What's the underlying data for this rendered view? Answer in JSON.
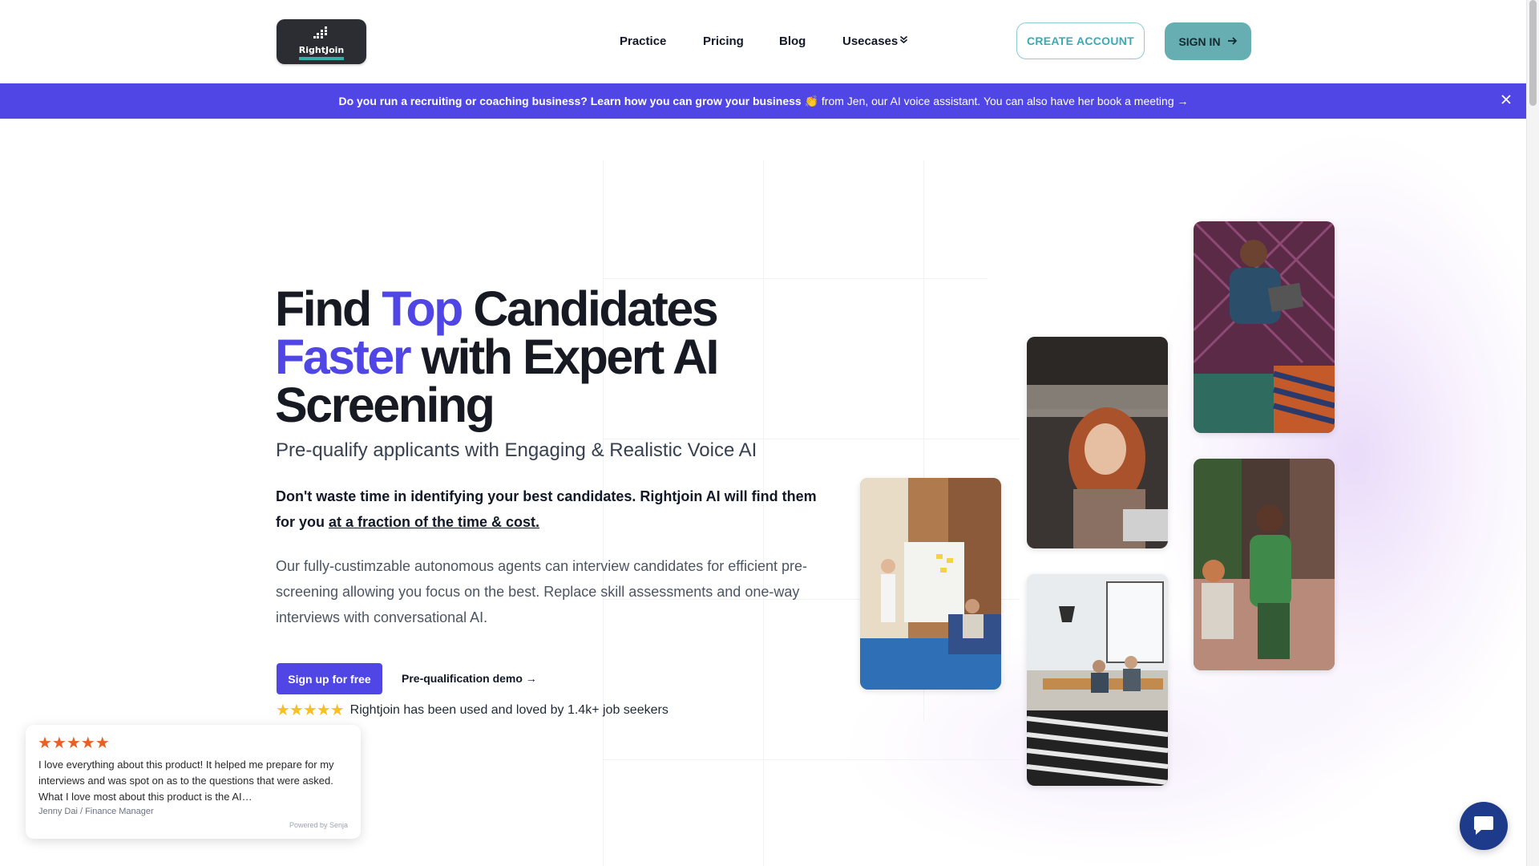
{
  "brand": {
    "name": "RightJoin"
  },
  "nav": {
    "items": [
      {
        "label": "Practice"
      },
      {
        "label": "Pricing"
      },
      {
        "label": "Blog"
      },
      {
        "label": "Usecases",
        "has_dropdown": true
      }
    ],
    "create_account": "CREATE ACCOUNT",
    "sign_in": "SIGN IN"
  },
  "announcement": {
    "bold_text": "Do you run a recruiting or coaching business? Learn how you can grow your business",
    "rest_text": " from Jen, our AI voice assistant. You can also have her book a meeting →",
    "emoji": "👏"
  },
  "hero": {
    "title": {
      "w1": "Find ",
      "w2": "Top",
      "w3": " Candidates",
      "w4": "Faster",
      "w5": " with Expert AI",
      "w6": "Screening"
    },
    "subtitle": "Pre-qualify applicants with Engaging & Realistic Voice AI",
    "lead_plain": "Don't waste time in identifying your best candidates. Rightjoin AI will find them for you ",
    "lead_underlined": "at a fraction of the time & cost.",
    "body": "Our fully-custimzable autonomous agents can interview candidates for efficient pre-screening allowing you focus on the best. Replace skill assessments and one-way interviews with conversational AI.",
    "cta_primary": "Sign up for free",
    "cta_secondary": "Pre-qualification demo →",
    "rating_stars": "★★★★★",
    "rating_text": "Rightjoin has been used and loved by 1.4k+ job seekers"
  },
  "testimonial": {
    "stars": "★★★★★",
    "quote": "I love everything about this product! It helped me prepare for my interviews and was spot on as to the questions that were asked. What I love most about this product is the AI…",
    "author": "Jenny Dai / Finance Manager",
    "powered_by": "Powered by Senja"
  },
  "colors": {
    "accent": "#4f46e5",
    "teal": "#67aeb3",
    "teal_outline": "#8ccdd2",
    "review_star": "#e4622a",
    "rating_star": "#fbbf24",
    "chat_bubble": "#1e3a8a"
  },
  "icons": {
    "close": "close-icon",
    "arrow": "arrow-right-icon",
    "chevron": "chevron-double-down-icon",
    "chat": "chat-bubble-icon"
  }
}
